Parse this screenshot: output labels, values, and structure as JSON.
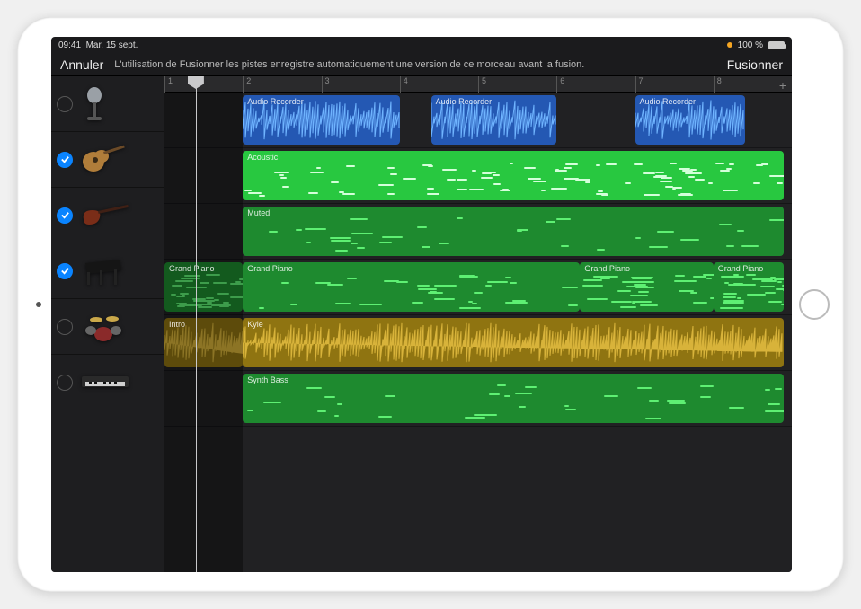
{
  "statusbar": {
    "time": "09:41",
    "date": "Mar. 15 sept.",
    "battery": "100 %"
  },
  "topbar": {
    "back_label": "Annuler",
    "hint_text": "L'utilisation de Fusionner les pistes enregistre automatiquement une version de ce morceau avant la fusion.",
    "merge_label": "Fusionner"
  },
  "ruler": {
    "bars": [
      "1",
      "2",
      "3",
      "4",
      "5",
      "6",
      "7",
      "8"
    ],
    "add_label": "+"
  },
  "playhead_bar": 1.4,
  "loop_intro_bars": 1.0,
  "tracks": [
    {
      "id": "mic",
      "selected": false,
      "instrument_icon": "mic-icon",
      "name": "Audio Recorder",
      "regions": [
        {
          "label": "Audio Recorder",
          "start": 2.0,
          "end": 4.0,
          "color": "blue",
          "content": "audio"
        },
        {
          "label": "Audio Recorder",
          "start": 4.4,
          "end": 6.0,
          "color": "blue",
          "content": "audio"
        },
        {
          "label": "Audio Recorder",
          "start": 7.0,
          "end": 8.4,
          "color": "blue",
          "content": "audio"
        }
      ]
    },
    {
      "id": "acoustic",
      "selected": true,
      "instrument_icon": "guitar-acoustic-icon",
      "name": "Acoustic",
      "regions": [
        {
          "label": "Acoustic",
          "start": 2.0,
          "end": 8.9,
          "color": "brightgreen",
          "content": "midi-dense"
        }
      ]
    },
    {
      "id": "bass",
      "selected": true,
      "instrument_icon": "guitar-bass-icon",
      "name": "Muted",
      "regions": [
        {
          "label": "Muted",
          "start": 2.0,
          "end": 8.9,
          "color": "green",
          "content": "midi-sparse"
        }
      ]
    },
    {
      "id": "piano",
      "selected": true,
      "instrument_icon": "piano-icon",
      "name": "Grand Piano",
      "regions": [
        {
          "label": "Grand Piano",
          "start": 1.0,
          "end": 2.0,
          "color": "green",
          "content": "midi-sparse"
        },
        {
          "label": "Grand Piano",
          "start": 2.0,
          "end": 6.3,
          "color": "green",
          "content": "midi-sparse"
        },
        {
          "label": "Grand Piano",
          "start": 6.3,
          "end": 8.0,
          "color": "green",
          "content": "midi-sparse"
        },
        {
          "label": "Grand Piano",
          "start": 8.0,
          "end": 8.9,
          "color": "green",
          "content": "midi-sparse"
        }
      ]
    },
    {
      "id": "drums",
      "selected": false,
      "instrument_icon": "drums-icon",
      "name": "Drums",
      "regions": [
        {
          "label": "Intro",
          "start": 1.0,
          "end": 2.0,
          "color": "yellow",
          "content": "audio"
        },
        {
          "label": "Kyle",
          "start": 2.0,
          "end": 8.9,
          "color": "yellow",
          "content": "audio"
        }
      ]
    },
    {
      "id": "synth",
      "selected": false,
      "instrument_icon": "keyboard-icon",
      "name": "Synth Bass",
      "regions": [
        {
          "label": "Synth Bass",
          "start": 2.0,
          "end": 8.9,
          "color": "green",
          "content": "midi-sparse"
        }
      ]
    }
  ],
  "colors": {
    "blue": "#2458b3",
    "green": "#1e8a2f",
    "brightgreen": "#28c840",
    "yellow": "#8f7411",
    "accent": "#0a84ff"
  }
}
